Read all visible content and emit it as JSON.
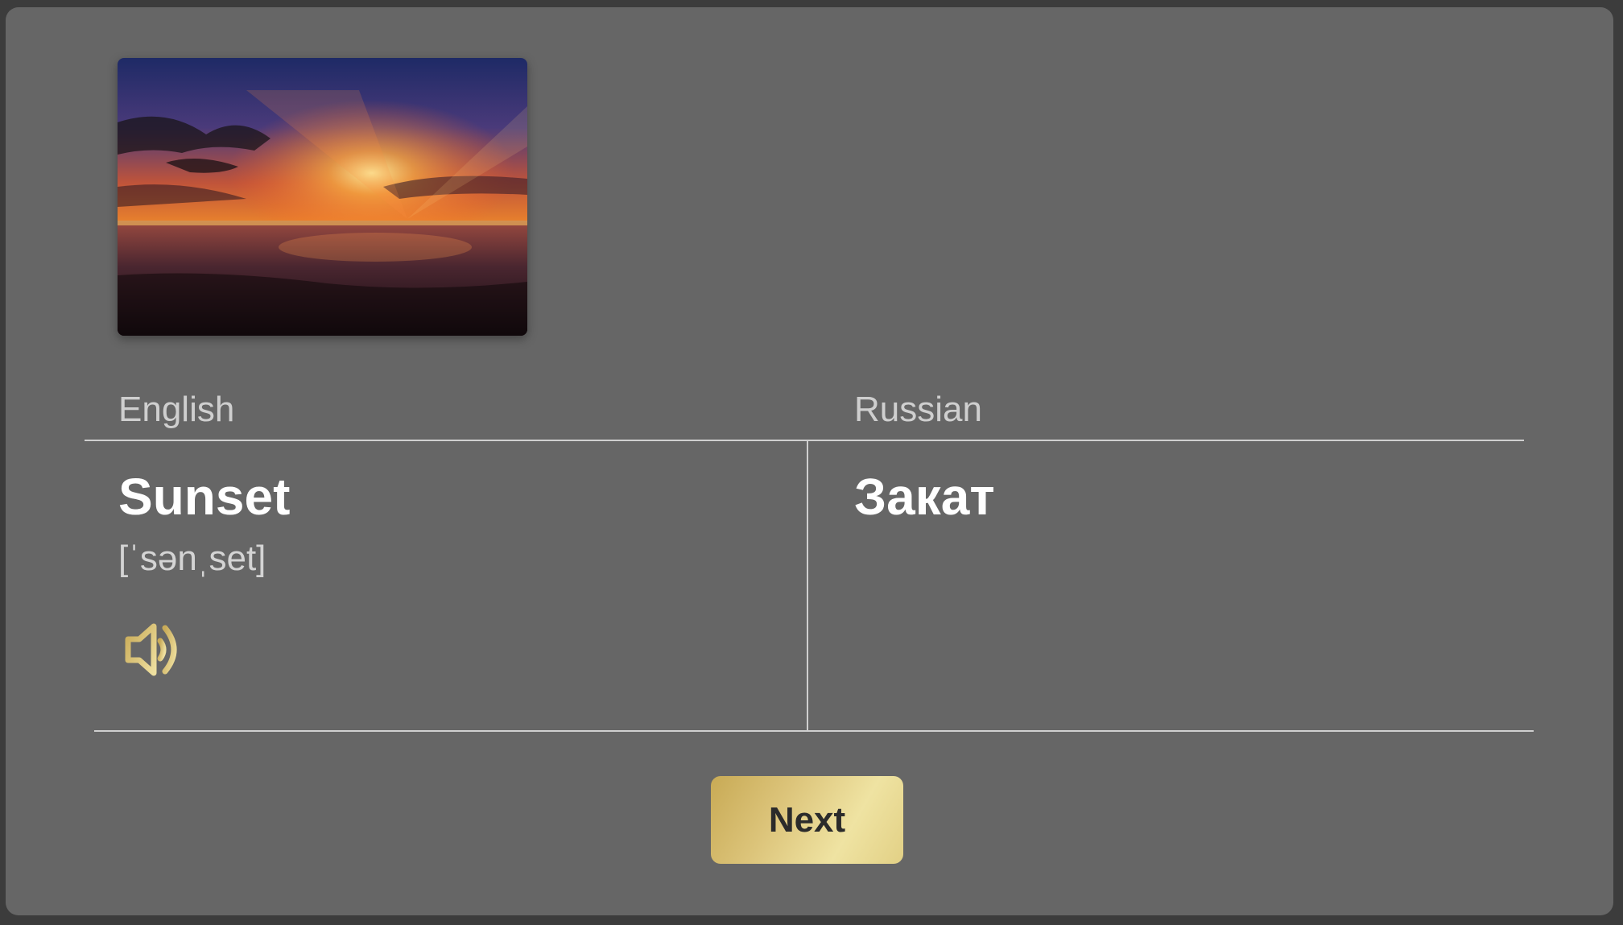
{
  "image": {
    "subject": "sunset-photo"
  },
  "columns": {
    "source_language": "English",
    "target_language": "Russian"
  },
  "card": {
    "word": "Sunset",
    "transcription": "[ˈsənˌset]",
    "translation": "Закат",
    "audio_icon": "speaker-icon"
  },
  "actions": {
    "next_label": "Next"
  },
  "colors": {
    "background": "#666666",
    "accent_gold": "#d8c070",
    "divider": "#cfcfcf"
  }
}
